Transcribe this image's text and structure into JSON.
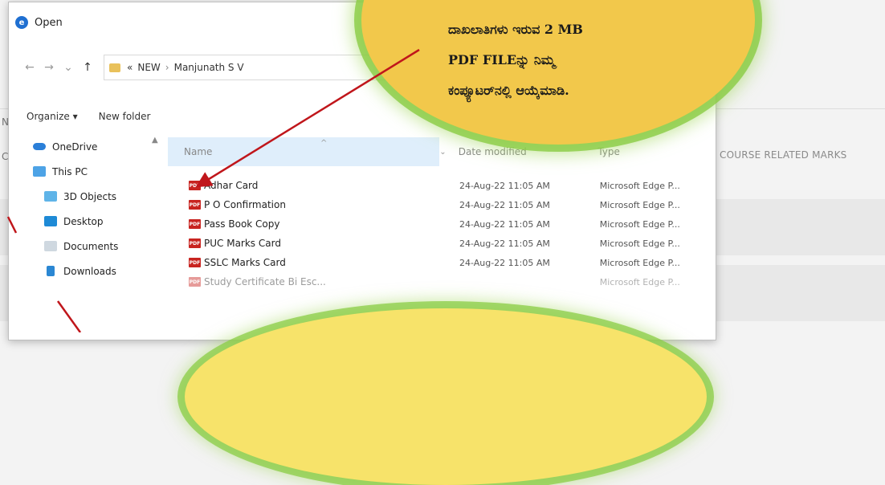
{
  "background": {
    "section_text": ", COURSE RELATED MARKS",
    "left_fragment_1": "N",
    "left_fragment_2": "C"
  },
  "dialog": {
    "title": "Open",
    "nav": {
      "back": "←",
      "forward": "→",
      "recent": "⌄",
      "up": "↑"
    },
    "breadcrumb": {
      "overflow": "«",
      "parts": [
        "NEW",
        "Manjunath S V"
      ]
    },
    "toolbar": {
      "organize": "Organize ▾",
      "new_folder": "New folder"
    },
    "sidebar": [
      {
        "label": "OneDrive",
        "icon": "cloud-icon"
      },
      {
        "label": "This PC",
        "icon": "computer-icon"
      },
      {
        "label": "3D Objects",
        "icon": "cube-icon"
      },
      {
        "label": "Desktop",
        "icon": "desktop-icon"
      },
      {
        "label": "Documents",
        "icon": "documents-icon"
      },
      {
        "label": "Downloads",
        "icon": "download-icon"
      }
    ],
    "columns": {
      "name": "Name",
      "date": "Date modified",
      "type": "Type"
    },
    "files": [
      {
        "name": "Adhar Card",
        "date": "24-Aug-22 11:05 AM",
        "type": "Microsoft Edge P..."
      },
      {
        "name": "P O Confirmation",
        "date": "24-Aug-22 11:05 AM",
        "type": "Microsoft Edge P..."
      },
      {
        "name": "Pass Book Copy",
        "date": "24-Aug-22 11:05 AM",
        "type": "Microsoft Edge P..."
      },
      {
        "name": "PUC Marks Card",
        "date": "24-Aug-22 11:05 AM",
        "type": "Microsoft Edge P..."
      },
      {
        "name": "SSLC Marks Card",
        "date": "24-Aug-22 11:05 AM",
        "type": "Microsoft Edge P..."
      },
      {
        "name": "Study Certificate Bi Esc...",
        "date": "",
        "type": "Microsoft Edge P..."
      }
    ]
  },
  "callout": {
    "line1": "ದಾಖಲಾತಿಗಳು ಇರುವ 2 MB",
    "line2": "PDF FILEನ್ನು ನಿಮ್ಮ",
    "line3": "ಕಂಪ್ಯೂಟರ್‌ನಲ್ಲಿ   ಆಯ್ಕೆಮಾಡಿ."
  },
  "colors": {
    "callout": "#f2c84b",
    "glow": "#8acc44",
    "arrow": "#c0161b",
    "pdf": "#c82420"
  }
}
